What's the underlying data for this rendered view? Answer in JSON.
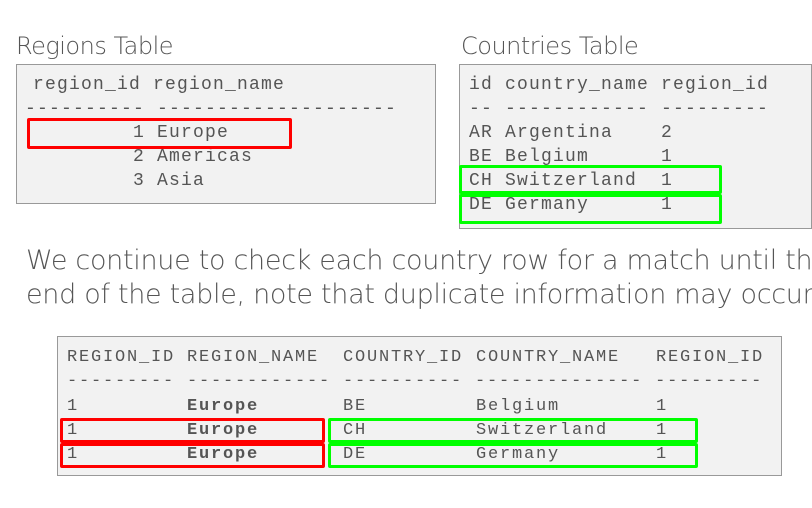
{
  "regions": {
    "title": "Regions Table",
    "header": " region_id region_name",
    "divider": "---------- --------------------",
    "rows": [
      "         1 Europe",
      "         2 Americas",
      "         3 Asia"
    ]
  },
  "countries": {
    "title": "Countries Table",
    "header": "id country_name region_id",
    "divider": "-- ------------ ---------",
    "rows": [
      "AR Argentina    2",
      "BE Belgium      1",
      "CH Switzerland  1",
      "DE Germany      1"
    ]
  },
  "paragraph": {
    "line1": "We continue to check each country row for a match until the",
    "line2": "end of the table, note that duplicate information may occur:"
  },
  "result": {
    "headers": [
      "REGION_ID",
      "REGION_NAME",
      "COUNTRY_ID",
      "COUNTRY_NAME",
      "REGION_ID"
    ],
    "divider": "--------- ------------ ---------- -------------- ---------",
    "rows": [
      [
        "1",
        "Europe",
        "BE",
        "Belgium",
        "1"
      ],
      [
        "1",
        "Europe",
        "CH",
        "Switzerland",
        "1"
      ],
      [
        "1",
        "Europe",
        "DE",
        "Germany",
        "1"
      ]
    ]
  },
  "colors": {
    "region_highlight": "#ff0000",
    "country_highlight": "#00ff00"
  }
}
